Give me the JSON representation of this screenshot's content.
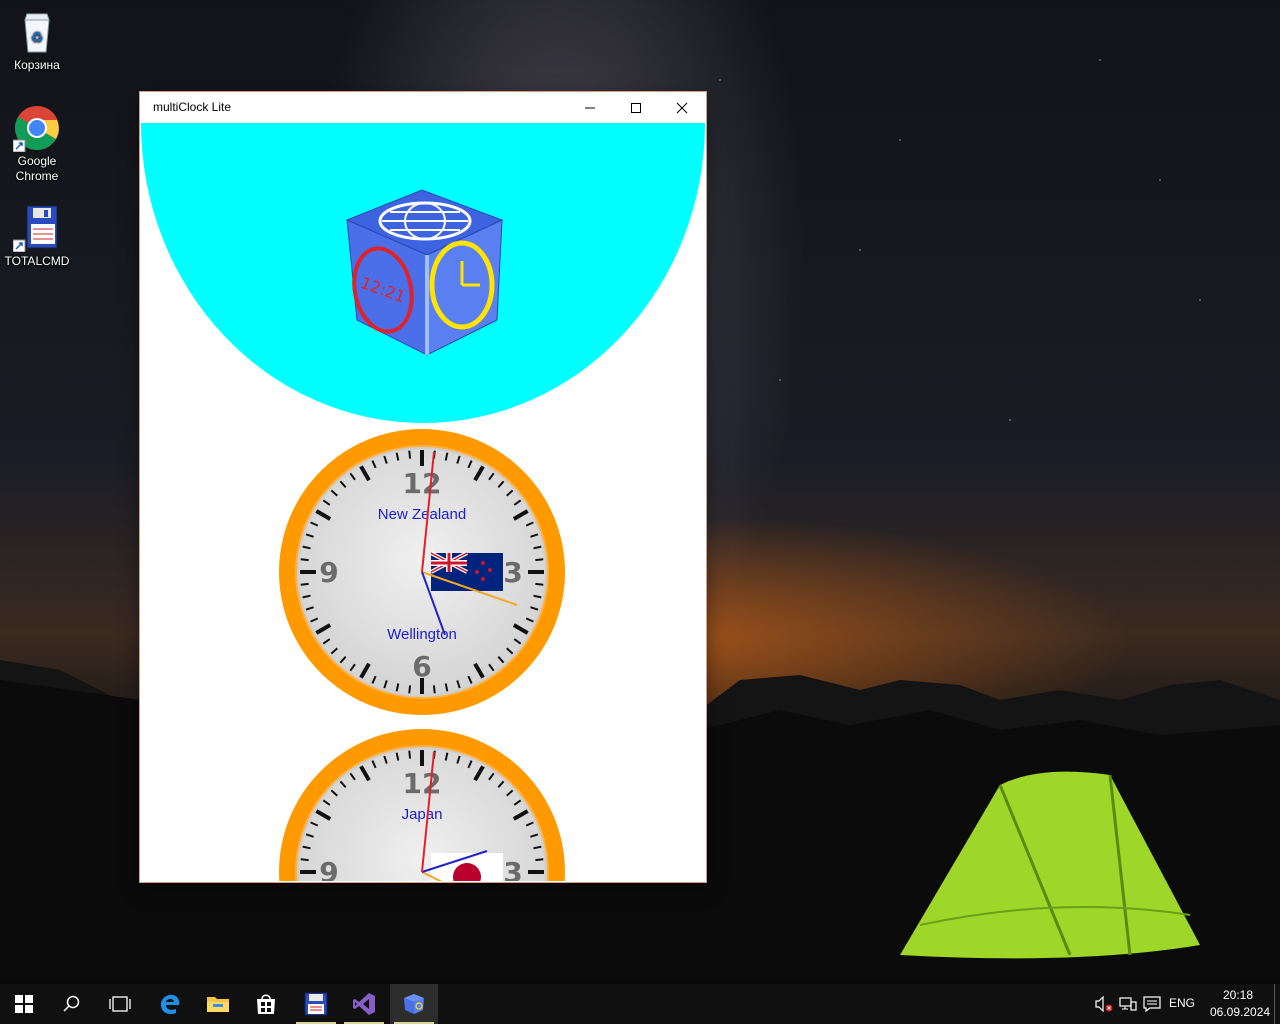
{
  "desktop": {
    "icons": [
      {
        "label": "Корзина"
      },
      {
        "label": "Google\nChrome"
      },
      {
        "label": "TOTALCMD"
      }
    ]
  },
  "window": {
    "title": "multiClock Lite",
    "logo_time": "12:21",
    "clocks": [
      {
        "country": "New Zealand",
        "city": "Wellington",
        "flag": "new-zealand-flag",
        "numerals": [
          "12",
          "3",
          "6",
          "9"
        ]
      },
      {
        "country": "Japan",
        "city": "",
        "flag": "japan-flag",
        "numerals": [
          "12",
          "3",
          "9"
        ]
      }
    ],
    "colors": {
      "header": "#00ffff",
      "bezel": "#ff9900",
      "label": "#1c1ccf"
    }
  },
  "taskbar": {
    "items": [
      "start-icon",
      "search-icon",
      "task-view-icon",
      "edge-icon",
      "file-explorer-icon",
      "store-icon",
      "totalcmd-icon",
      "visual-studio-icon",
      "multiclock-icon"
    ],
    "language": "ENG",
    "time": "20:18",
    "date": "06.09.2024"
  }
}
